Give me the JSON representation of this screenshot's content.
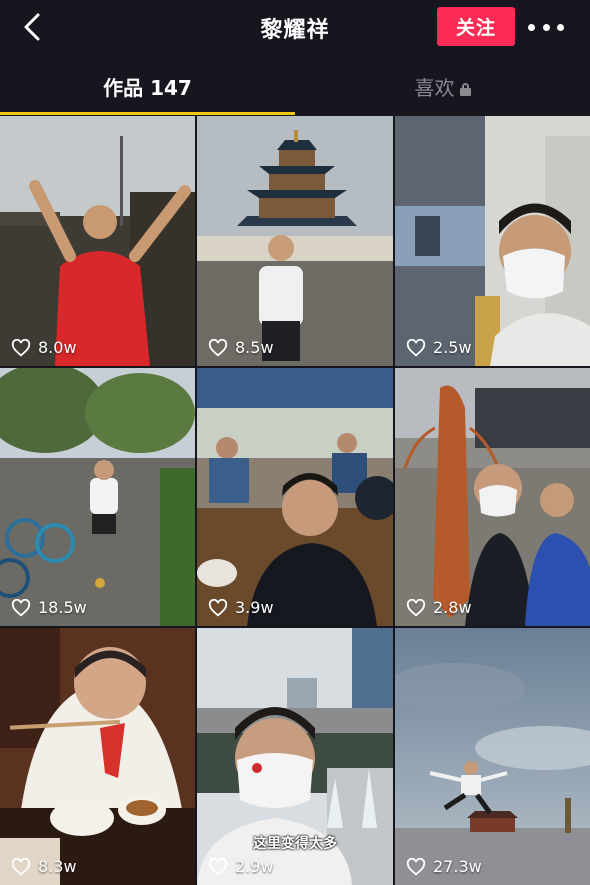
{
  "header": {
    "title": "黎耀祥",
    "follow_label": "关注"
  },
  "tabs": {
    "works_label": "作品 147",
    "likes_label": "喜欢"
  },
  "videos": [
    {
      "likes": "8.0w",
      "caption": ""
    },
    {
      "likes": "8.5w",
      "caption": ""
    },
    {
      "likes": "2.5w",
      "caption": ""
    },
    {
      "likes": "18.5w",
      "caption": ""
    },
    {
      "likes": "3.9w",
      "caption": ""
    },
    {
      "likes": "2.8w",
      "caption": ""
    },
    {
      "likes": "8.3w",
      "caption": ""
    },
    {
      "likes": "2.9w",
      "caption": "这里变得太多"
    },
    {
      "likes": "27.3w",
      "caption": ""
    }
  ],
  "colors": {
    "accent": "#fe2c55",
    "tab_indicator": "#f5c710",
    "background": "#15161e"
  }
}
